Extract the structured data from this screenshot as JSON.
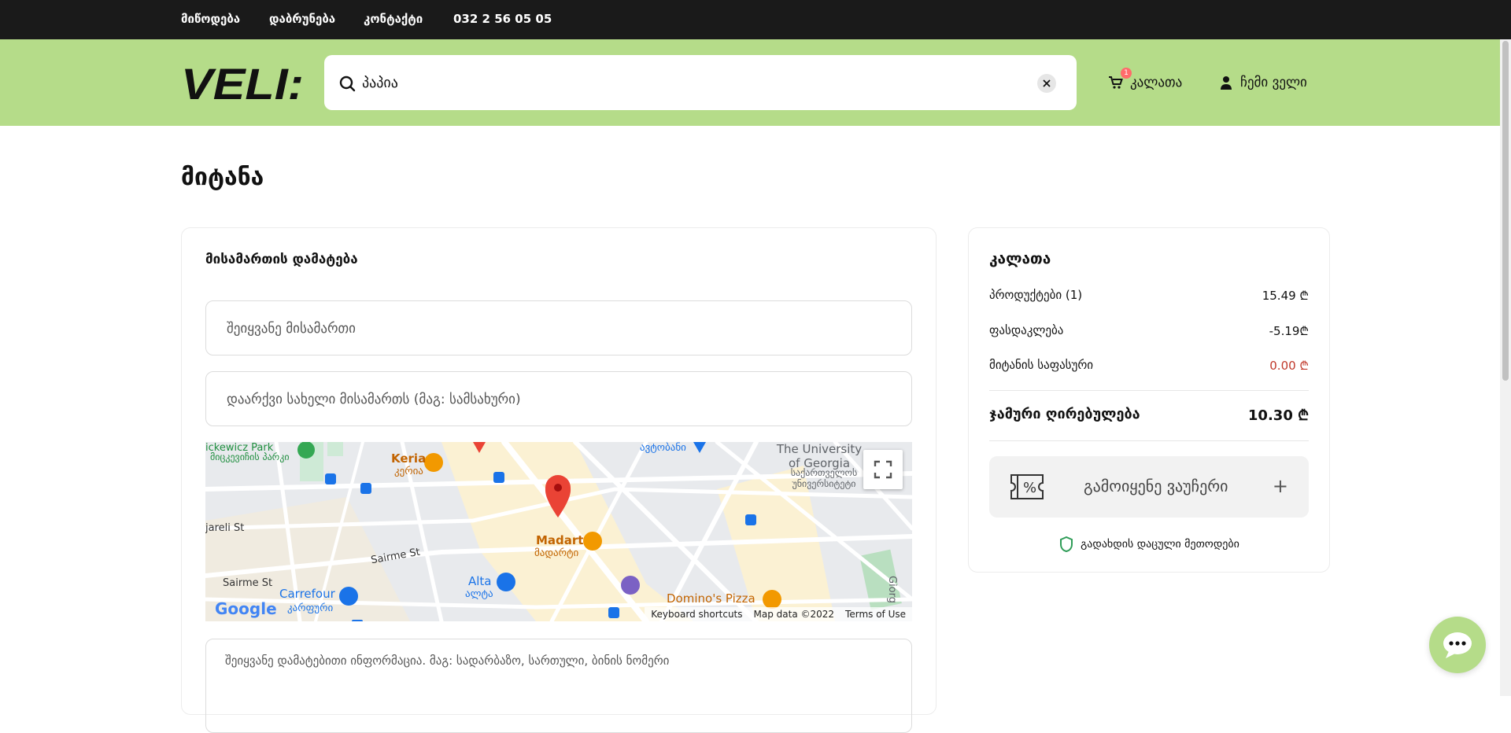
{
  "topbar": {
    "links": [
      "მიწოდება",
      "დაბრუნება",
      "კონტაქტი"
    ],
    "phone": "032 2 56 05 05"
  },
  "header": {
    "logo_text": "VELI:",
    "search": {
      "value": "პაპია",
      "icon": "search-icon",
      "clear_icon": "close-icon"
    },
    "cart": {
      "label": "კალათა",
      "badge": "1",
      "icon": "cart-icon"
    },
    "account": {
      "label": "ჩემი ველი",
      "icon": "user-icon"
    }
  },
  "page": {
    "title": "მიტანა"
  },
  "address_card": {
    "title": "მისამართის დამატება",
    "address_placeholder": "შეიყვანე მისამართი",
    "name_placeholder": "დაარქვი სახელი მისამართს (მაგ: სამსახური)",
    "details_placeholder": "შეიყვანე დამატებითი ინფორმაცია. მაგ: სადარბაზო, სართული, ბინის ნომერი",
    "map": {
      "labels": {
        "park": "ickewicz Park",
        "park_ka": "მიცკევიჩის პარკი",
        "keria": "Keria",
        "keria_ka": "კერია",
        "bus_station": "ავტობანი",
        "university": "The University of Georgia",
        "university_ka": "საქართველოს უნივერსიტეტი",
        "street1": "jareli St",
        "street2": "Sairme St",
        "street3": "Sairme St",
        "madart": "Madart",
        "madart_ka": "მადარტი",
        "carrefour": "Carrefour",
        "carrefour_ka": "კარფური",
        "alta": "Alta",
        "alta_ka": "ალტა",
        "dominos": "Domino's Pizza",
        "giorgi": "Giorg"
      },
      "google": "Google",
      "attribution": [
        "Keyboard shortcuts",
        "Map data ©2022",
        "Terms of Use"
      ],
      "fullscreen_icon": "fullscreen-icon"
    }
  },
  "cart_card": {
    "title": "კალათა",
    "rows": [
      {
        "label": "პროდუქტები (1)",
        "value": "15.49 ₾"
      },
      {
        "label": "ფასდაკლება",
        "value": "-5.19₾"
      },
      {
        "label": "მიტანის საფასური",
        "value": "0.00 ₾"
      }
    ],
    "total_label": "ჯამური ღირებულება",
    "total_value": "10.30 ₾",
    "voucher_label": "გამოიყენე ვაუჩერი",
    "voucher_plus": "+",
    "secure_label": "გადახდის დაცული მეთოდები",
    "colors": {
      "delivery_fee": "#c0392b",
      "accent": "#b5dc89"
    }
  },
  "chat": {
    "icon": "chat-icon"
  }
}
